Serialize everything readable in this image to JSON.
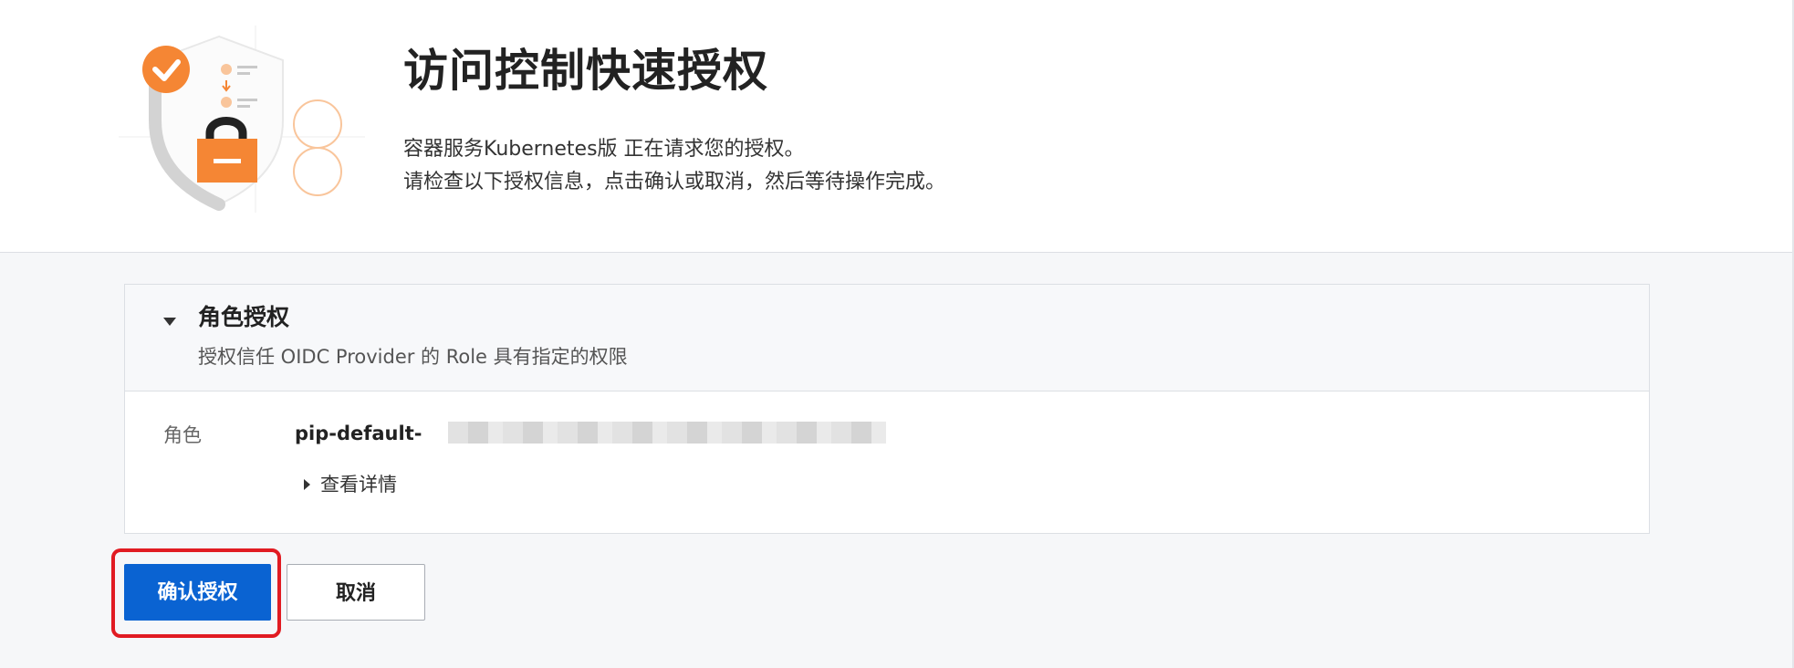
{
  "header": {
    "title": "访问控制快速授权",
    "description_line1": "容器服务Kubernetes版 正在请求您的授权。",
    "description_line2": "请检查以下授权信息，点击确认或取消，然后等待操作完成。",
    "illustration_icon": "shield-lock-check-icon",
    "accent_color": "#f58634"
  },
  "panel": {
    "title": "角色授权",
    "subtitle": "授权信任 OIDC Provider 的 Role 具有指定的权限",
    "role_label": "角色",
    "role_value": "pip-default-",
    "details_label": "查看详情"
  },
  "actions": {
    "confirm_label": "确认授权",
    "cancel_label": "取消",
    "primary_color": "#0a63d2",
    "highlight_color": "#e11b22"
  }
}
